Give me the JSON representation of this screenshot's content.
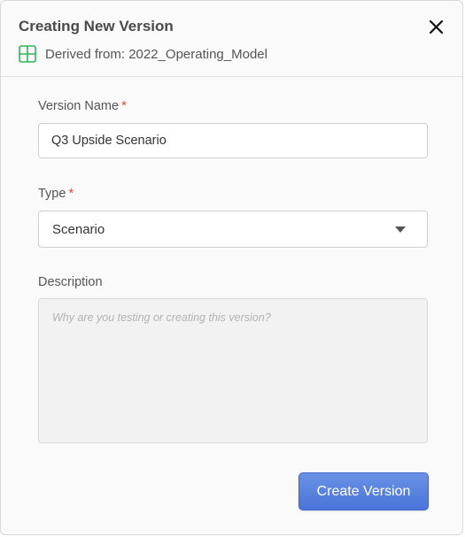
{
  "dialog": {
    "title": "Creating New Version",
    "derived_from": "Derived from: 2022_Operating_Model",
    "close_icon": "close-icon",
    "source_icon": "spreadsheet-grid-icon"
  },
  "form": {
    "version_name": {
      "label": "Version Name",
      "required_marker": "*",
      "value": "Q3 Upside Scenario"
    },
    "type": {
      "label": "Type",
      "required_marker": "*",
      "selected": "Scenario"
    },
    "description": {
      "label": "Description",
      "placeholder": "Why are you testing or creating this version?",
      "value": ""
    }
  },
  "actions": {
    "create_label": "Create Version"
  },
  "colors": {
    "accent": "#4a74d8",
    "required": "#e0453a",
    "grid_icon": "#2fb35a"
  }
}
